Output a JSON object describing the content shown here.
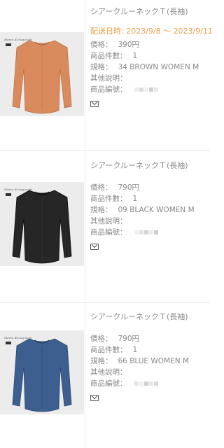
{
  "orders": [
    {
      "title": "シアークルーネックＴ(長袖)",
      "shipping_date": "配送日時: 2023/9/8 〜 2023/9/11",
      "price_label": "價格：",
      "price": "390円",
      "quantity_label": "商品件數：",
      "quantity": "1",
      "spec_label": "規格：",
      "spec": "34 BROWN WOMEN M",
      "other_label": "其他說明：",
      "product_no_label": "商品編號：",
      "color": "#d98b5e",
      "icon": "mail-icon"
    },
    {
      "title": "シアークルーネックＴ(長袖)",
      "price_label": "價格：",
      "price": "790円",
      "quantity_label": "商品件數：",
      "quantity": "1",
      "spec_label": "規格：",
      "spec": "09 BLACK WOMEN M",
      "other_label": "其他說明：",
      "product_no_label": "商品編號：",
      "color": "#262626",
      "icon": "mail-icon"
    },
    {
      "title": "シアークルーネックＴ(長袖)",
      "price_label": "價格：",
      "price": "790円",
      "quantity_label": "商品件數：",
      "quantity": "1",
      "spec_label": "規格：",
      "spec": "66 BLUE WOMEN M",
      "other_label": "其他說明：",
      "product_no_label": "商品編號：",
      "color": "#3d5f8f",
      "icon": "mail-icon"
    }
  ]
}
